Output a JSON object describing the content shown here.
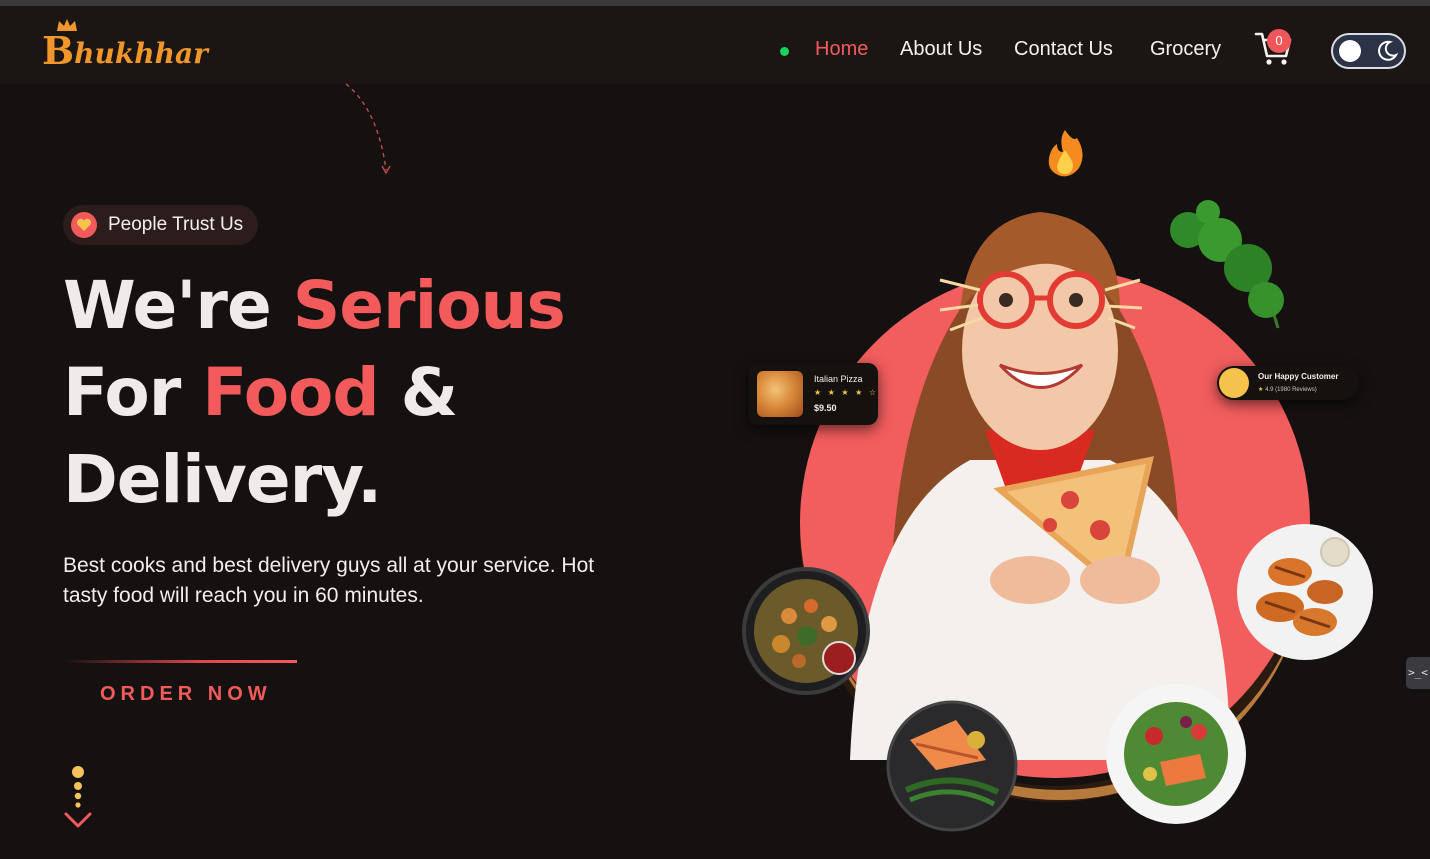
{
  "brand": {
    "logo_letter": "B",
    "logo_rest": "hukhhar"
  },
  "nav": {
    "links": [
      {
        "label": "Home",
        "active": true
      },
      {
        "label": "About Us",
        "active": false
      },
      {
        "label": "Contact Us",
        "active": false
      },
      {
        "label": "Grocery",
        "active": false
      }
    ],
    "cart_count": "0",
    "theme_toggle": "dark"
  },
  "hero": {
    "badge": "People Trust Us",
    "headline": {
      "line1_plain": "We're ",
      "line1_accent": "Serious",
      "line2_plain": "For ",
      "line2_accent": "Food",
      "line2_tail": " &",
      "line3": "Delivery."
    },
    "subtext": "Best cooks and best delivery guys all at your service. Hot tasty food will reach you in 60 minutes.",
    "cta": "ORDER NOW"
  },
  "cards": {
    "pizza": {
      "title": "Italian Pizza",
      "stars": "★ ★ ★ ★ ☆",
      "price": "$9.50"
    },
    "customer": {
      "title": "Our Happy Customer",
      "star": "★",
      "rating": "4.9",
      "reviews": "(1980 Reviews)"
    }
  },
  "side_tab": ">_<",
  "colors": {
    "accent": "#f35a5c",
    "background": "#151110",
    "nav_bg": "#1b1614",
    "logo": "#f0962a",
    "online_dot": "#1bd35b"
  }
}
